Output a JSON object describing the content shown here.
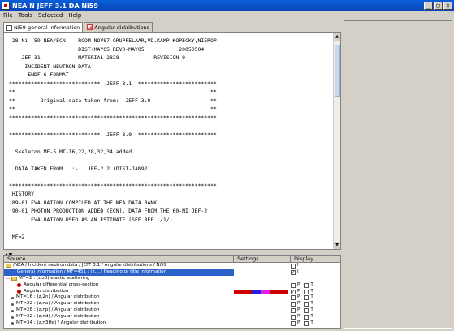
{
  "window": {
    "title": "NEA N JEFF 3.1 DA Ni59",
    "minimize": "_",
    "maximize": "□",
    "close": "x"
  },
  "menu": [
    "File",
    "Tools",
    "Selected",
    "Help"
  ],
  "tabs": [
    {
      "label": "Ni59 general information",
      "icon": "document-icon",
      "active": true
    },
    {
      "label": "Angular distributions",
      "icon": "chart-icon",
      "active": false
    }
  ],
  "text_lines": [
    " 28-Ni- 59 NEA/ECN    RCOM-NOV87 GRUPPELAAR,VD.KAMP,KOPECKY,NIEROP",
    "                      DIST-MAY05 REV0-MAY05           20050504",
    "----JEF-31            MATERIAL 2828           REVISION 0",
    "-----INCIDENT NEUTRON DATA",
    "------ENDF-6 FORMAT",
    "*****************************  JEFF-3.1  *************************",
    "**                                                              **",
    "**        Original data taken from:  JEFF-3.0                   **",
    "**                                                              **",
    "******************************************************************",
    "",
    "*****************************  JEFF-3.0  *************************",
    "",
    "  Skeleton MF-5 MT-16,22,28,32,34 added",
    "",
    "  DATA TAKEN FROM   :-   JEF-2.2 (DIST-JAN92)",
    "",
    "******************************************************************",
    " HISTORY",
    " 89-01 EVALUATION COMPILED AT THE NEA DATA BANK.",
    " 90-01 PHOTON PRODUCTION ADDED (ECN). DATA FROM THE 60-NI JEF-2",
    "       EVALUATION USED AS AN ESTIMATE (SEE REF. /1/).",
    "",
    " MF=2"
  ],
  "splitter": {
    "arrows": "▲▼"
  },
  "columns": {
    "source": "Source",
    "settings": "Settings",
    "display": "Display"
  },
  "tree": [
    {
      "label": "/NEA / Incident neutron data / JEFF 3.1 / Angular distributions / Ni59",
      "indent": 0,
      "icon": "folder",
      "twist": "",
      "settings": "",
      "checks": [
        "I"
      ],
      "checked": [
        false
      ]
    },
    {
      "label": "General information / MF=451 : (z,...) Heading or title information",
      "indent": 2,
      "icon": "none",
      "twist": "",
      "settings": "",
      "checks": [
        "I"
      ],
      "checked": [
        true
      ],
      "selected": true
    },
    {
      "label": "MT=2 : (z,z0) elastic scattering",
      "indent": 0,
      "icon": "folder",
      "twist": "−",
      "settings": "",
      "checks": [],
      "checked": []
    },
    {
      "label": "Angular differential cross-section",
      "indent": 2,
      "icon": "red",
      "twist": "",
      "settings": "",
      "checks": [
        "P",
        "T"
      ],
      "checked": [
        false,
        false
      ]
    },
    {
      "label": "Angular distribution",
      "indent": 2,
      "icon": "red",
      "twist": "",
      "settings": "colorbar",
      "checks": [
        "P",
        "T"
      ],
      "checked": [
        true,
        false
      ]
    },
    {
      "label": "MT=16 : (z,2n) / Angular distribution",
      "indent": 1,
      "icon": "gray",
      "twist": "",
      "settings": "",
      "checks": [
        "P",
        "T"
      ],
      "checked": [
        false,
        false
      ]
    },
    {
      "label": "MT=22 : (z,na) / Angular distribution",
      "indent": 1,
      "icon": "gray",
      "twist": "",
      "settings": "",
      "checks": [
        "P",
        "T"
      ],
      "checked": [
        false,
        false
      ]
    },
    {
      "label": "MT=28 : (z,np) / Angular distribution",
      "indent": 1,
      "icon": "gray",
      "twist": "",
      "settings": "",
      "checks": [
        "P",
        "T"
      ],
      "checked": [
        false,
        false
      ]
    },
    {
      "label": "MT=32 : (z,nd) / Angular distribution",
      "indent": 1,
      "icon": "gray",
      "twist": "",
      "settings": "",
      "checks": [
        "P",
        "T"
      ],
      "checked": [
        false,
        false
      ]
    },
    {
      "label": "MT=34 : (z,n3He) / Angular distribution",
      "indent": 1,
      "icon": "gray",
      "twist": "",
      "settings": "",
      "checks": [
        "P",
        "T"
      ],
      "checked": [
        false,
        false
      ]
    }
  ],
  "colorbar_colors": [
    "#d00000",
    "#d00000",
    "#2020e0",
    "#e020e0",
    "#d00000",
    "#d00000"
  ],
  "colors": {
    "titlebar": "#0843b8",
    "selection": "#2a62c9",
    "window_bg": "#d4d0c8"
  }
}
